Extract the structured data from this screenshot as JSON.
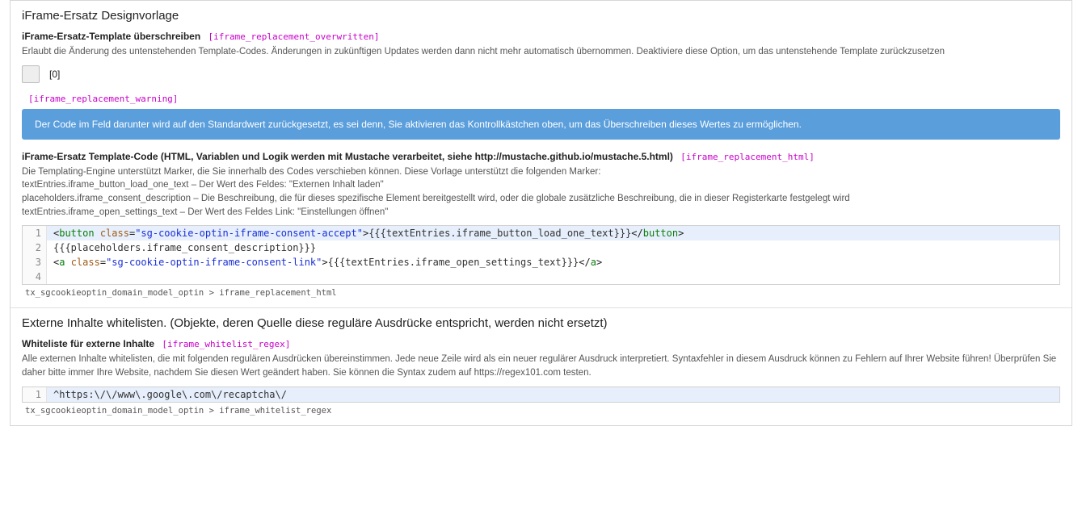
{
  "section1": {
    "title": "iFrame-Ersatz Designvorlage",
    "field1": {
      "label": "iFrame-Ersatz-Template überschreiben",
      "key": "[iframe_replacement_overwritten]",
      "desc": "Erlaubt die Änderung des untenstehenden Template-Codes. Änderungen in zukünftigen Updates werden dann nicht mehr automatisch übernommen. Deaktiviere diese Option, um das untenstehende Template zurückzusetzen",
      "checkbox_label": "[0]"
    },
    "warning_key": "[iframe_replacement_warning]",
    "alert_text": "Der Code im Feld darunter wird auf den Standardwert zurückgesetzt, es sei denn, Sie aktivieren das Kontrollkästchen oben, um das Überschreiben dieses Wertes zu ermöglichen.",
    "field2": {
      "label": "iFrame-Ersatz Template-Code (HTML, Variablen und Logik werden mit Mustache verarbeitet, siehe http://mustache.github.io/mustache.5.html)",
      "key": "[iframe_replacement_html]",
      "desc_l1": "Die Templating-Engine unterstützt Marker, die Sie innerhalb des Codes verschieben können. Diese Vorlage unterstützt die folgenden Marker:",
      "desc_l2": "textEntries.iframe_button_load_one_text – Der Wert des Feldes: \"Externen Inhalt laden\"",
      "desc_l3": "placeholders.iframe_consent_description – Die Beschreibung, die für dieses spezifische Element bereitgestellt wird, oder die globale zusätzliche Beschreibung, die in dieser Registerkarte festgelegt wird",
      "desc_l4": "textEntries.iframe_open_settings_text – Der Wert des Feldes Link: \"Einstellungen öffnen\"",
      "code": {
        "l1": {
          "tag": "button",
          "attr": "class",
          "str": "\"sg-cookie-optin-iframe-consent-accept\"",
          "inner": "{{{textEntries.iframe_button_load_one_text}}}"
        },
        "l2": "{{{placeholders.iframe_consent_description}}}",
        "l3": {
          "tag": "a",
          "attr": "class",
          "str": "\"sg-cookie-optin-iframe-consent-link\"",
          "inner": "{{{textEntries.iframe_open_settings_text}}}"
        }
      },
      "path": "tx_sgcookieoptin_domain_model_optin > iframe_replacement_html"
    }
  },
  "section2": {
    "title": "Externe Inhalte whitelisten. (Objekte, deren Quelle diese reguläre Ausdrücke entspricht, werden nicht ersetzt)",
    "field1": {
      "label": "Whiteliste für externe Inhalte",
      "key": "[iframe_whitelist_regex]",
      "desc": "Alle externen Inhalte whitelisten, die mit folgenden regulären Ausdrücken übereinstimmen. Jede neue Zeile wird als ein neuer regulärer Ausdruck interpretiert. Syntaxfehler in diesem Ausdruck können zu Fehlern auf Ihrer Website führen! Überprüfen Sie daher bitte immer Ihre Website, nachdem Sie diesen Wert geändert haben. Sie können die Syntax zudem auf https://regex101.com testen.",
      "code_l1": "^https:\\/\\/www\\.google\\.com\\/recaptcha\\/",
      "path": "tx_sgcookieoptin_domain_model_optin > iframe_whitelist_regex"
    }
  }
}
